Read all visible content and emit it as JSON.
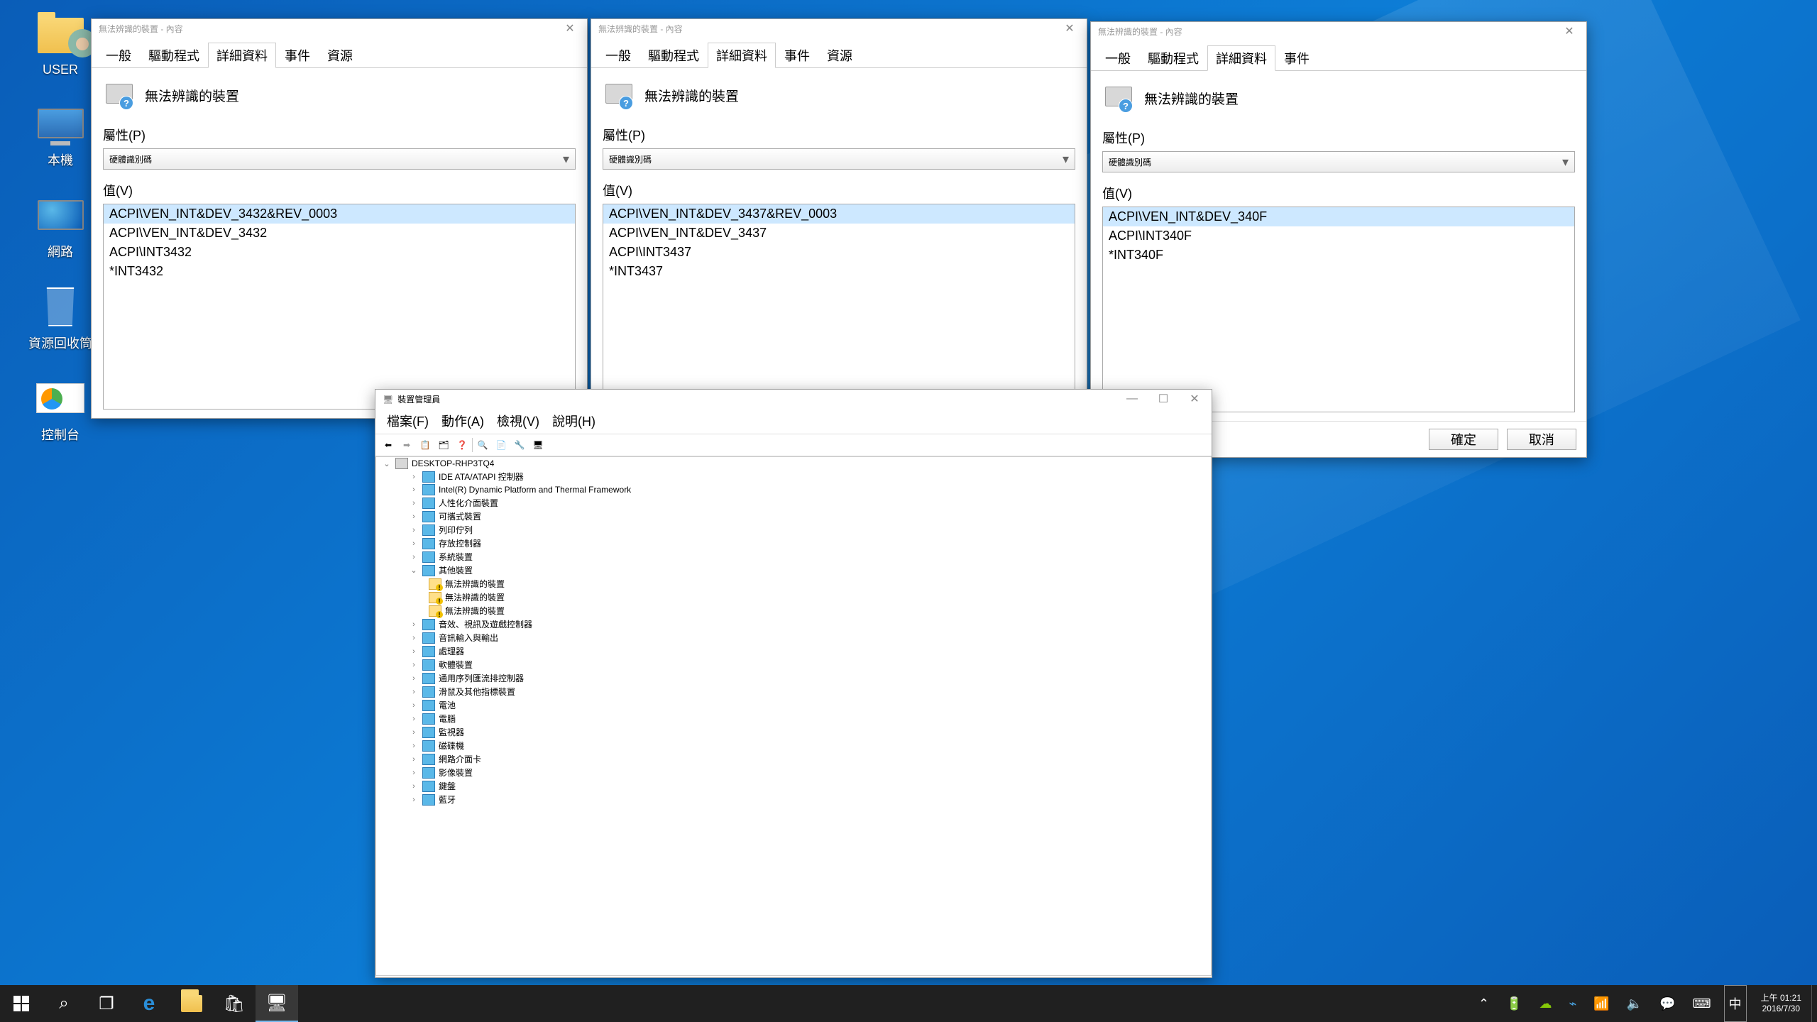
{
  "desktop": {
    "icons": [
      "USER",
      "本機",
      "網路",
      "資源回收筒",
      "控制台"
    ]
  },
  "prop_windows": [
    {
      "title": "無法辨識的裝置 - 內容",
      "device_name": "無法辨識的裝置",
      "tabs": [
        "一般",
        "驅動程式",
        "詳細資料",
        "事件",
        "資源"
      ],
      "active_tab": 2,
      "property_label": "屬性(P)",
      "property_value": "硬體識別碼",
      "value_label": "值(V)",
      "values": [
        "ACPI\\VEN_INT&DEV_3432&REV_0003",
        "ACPI\\VEN_INT&DEV_3432",
        "ACPI\\INT3432",
        "*INT3432"
      ]
    },
    {
      "title": "無法辨識的裝置 - 內容",
      "device_name": "無法辨識的裝置",
      "tabs": [
        "一般",
        "驅動程式",
        "詳細資料",
        "事件",
        "資源"
      ],
      "active_tab": 2,
      "property_label": "屬性(P)",
      "property_value": "硬體識別碼",
      "value_label": "值(V)",
      "values": [
        "ACPI\\VEN_INT&DEV_3437&REV_0003",
        "ACPI\\VEN_INT&DEV_3437",
        "ACPI\\INT3437",
        "*INT3437"
      ]
    },
    {
      "title": "無法辨識的裝置 - 內容",
      "device_name": "無法辨識的裝置",
      "tabs": [
        "一般",
        "驅動程式",
        "詳細資料",
        "事件"
      ],
      "active_tab": 2,
      "property_label": "屬性(P)",
      "property_value": "硬體識別碼",
      "value_label": "值(V)",
      "values": [
        "ACPI\\VEN_INT&DEV_340F",
        "ACPI\\INT340F",
        "*INT340F"
      ],
      "ok": "確定",
      "cancel": "取消"
    }
  ],
  "devmgr": {
    "title": "裝置管理員",
    "menu": [
      "檔案(F)",
      "動作(A)",
      "檢視(V)",
      "說明(H)"
    ],
    "root": "DESKTOP-RHP3TQ4",
    "nodes": [
      {
        "l": "IDE ATA/ATAPI 控制器",
        "i": 1
      },
      {
        "l": "Intel(R) Dynamic Platform and Thermal Framework",
        "i": 1
      },
      {
        "l": "人性化介面裝置",
        "i": 1
      },
      {
        "l": "可攜式裝置",
        "i": 1
      },
      {
        "l": "列印佇列",
        "i": 1
      },
      {
        "l": "存放控制器",
        "i": 1
      },
      {
        "l": "系統裝置",
        "i": 1
      },
      {
        "l": "其他裝置",
        "i": 1,
        "exp": true
      },
      {
        "l": "無法辨識的裝置",
        "i": 2,
        "warn": true
      },
      {
        "l": "無法辨識的裝置",
        "i": 2,
        "warn": true
      },
      {
        "l": "無法辨識的裝置",
        "i": 2,
        "warn": true
      },
      {
        "l": "音效、視訊及遊戲控制器",
        "i": 1
      },
      {
        "l": "音訊輸入與輸出",
        "i": 1
      },
      {
        "l": "處理器",
        "i": 1
      },
      {
        "l": "軟體裝置",
        "i": 1
      },
      {
        "l": "通用序列匯流排控制器",
        "i": 1
      },
      {
        "l": "滑鼠及其他指標裝置",
        "i": 1
      },
      {
        "l": "電池",
        "i": 1
      },
      {
        "l": "電腦",
        "i": 1
      },
      {
        "l": "監視器",
        "i": 1
      },
      {
        "l": "磁碟機",
        "i": 1
      },
      {
        "l": "網路介面卡",
        "i": 1
      },
      {
        "l": "影像裝置",
        "i": 1
      },
      {
        "l": "鍵盤",
        "i": 1
      },
      {
        "l": "藍牙",
        "i": 1
      }
    ]
  },
  "taskbar": {
    "time": "上午 01:21",
    "date": "2016/7/30",
    "ime": "中"
  }
}
